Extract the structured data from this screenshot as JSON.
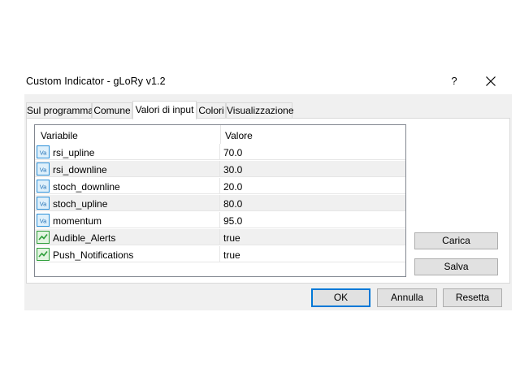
{
  "window": {
    "title": "Custom Indicator - gLoRy v1.2",
    "help_label": "?"
  },
  "tabs": [
    {
      "label": "Sul programma",
      "active": false
    },
    {
      "label": "Comune",
      "active": false
    },
    {
      "label": "Valori di input",
      "active": true
    },
    {
      "label": "Colori",
      "active": false
    },
    {
      "label": "Visualizzazione",
      "active": false
    }
  ],
  "grid": {
    "columns": {
      "variable": "Variabile",
      "value": "Valore"
    },
    "rows": [
      {
        "name": "rsi_upline",
        "value": "70.0",
        "icon": "numeric-value-icon"
      },
      {
        "name": "rsi_downline",
        "value": "30.0",
        "icon": "numeric-value-icon"
      },
      {
        "name": "stoch_downline",
        "value": "20.0",
        "icon": "numeric-value-icon"
      },
      {
        "name": "stoch_upline",
        "value": "80.0",
        "icon": "numeric-value-icon"
      },
      {
        "name": "momentum",
        "value": "95.0",
        "icon": "numeric-value-icon"
      },
      {
        "name": "Audible_Alerts",
        "value": "true",
        "icon": "boolean-value-icon"
      },
      {
        "name": "Push_Notifications",
        "value": "true",
        "icon": "boolean-value-icon"
      }
    ]
  },
  "buttons": {
    "load": "Carica",
    "save": "Salva",
    "ok": "OK",
    "cancel": "Annulla",
    "reset": "Resetta"
  },
  "colors": {
    "accent": "#0078d7",
    "numeric_icon": "#2a8fd8",
    "boolean_icon": "#2e9e3a"
  }
}
